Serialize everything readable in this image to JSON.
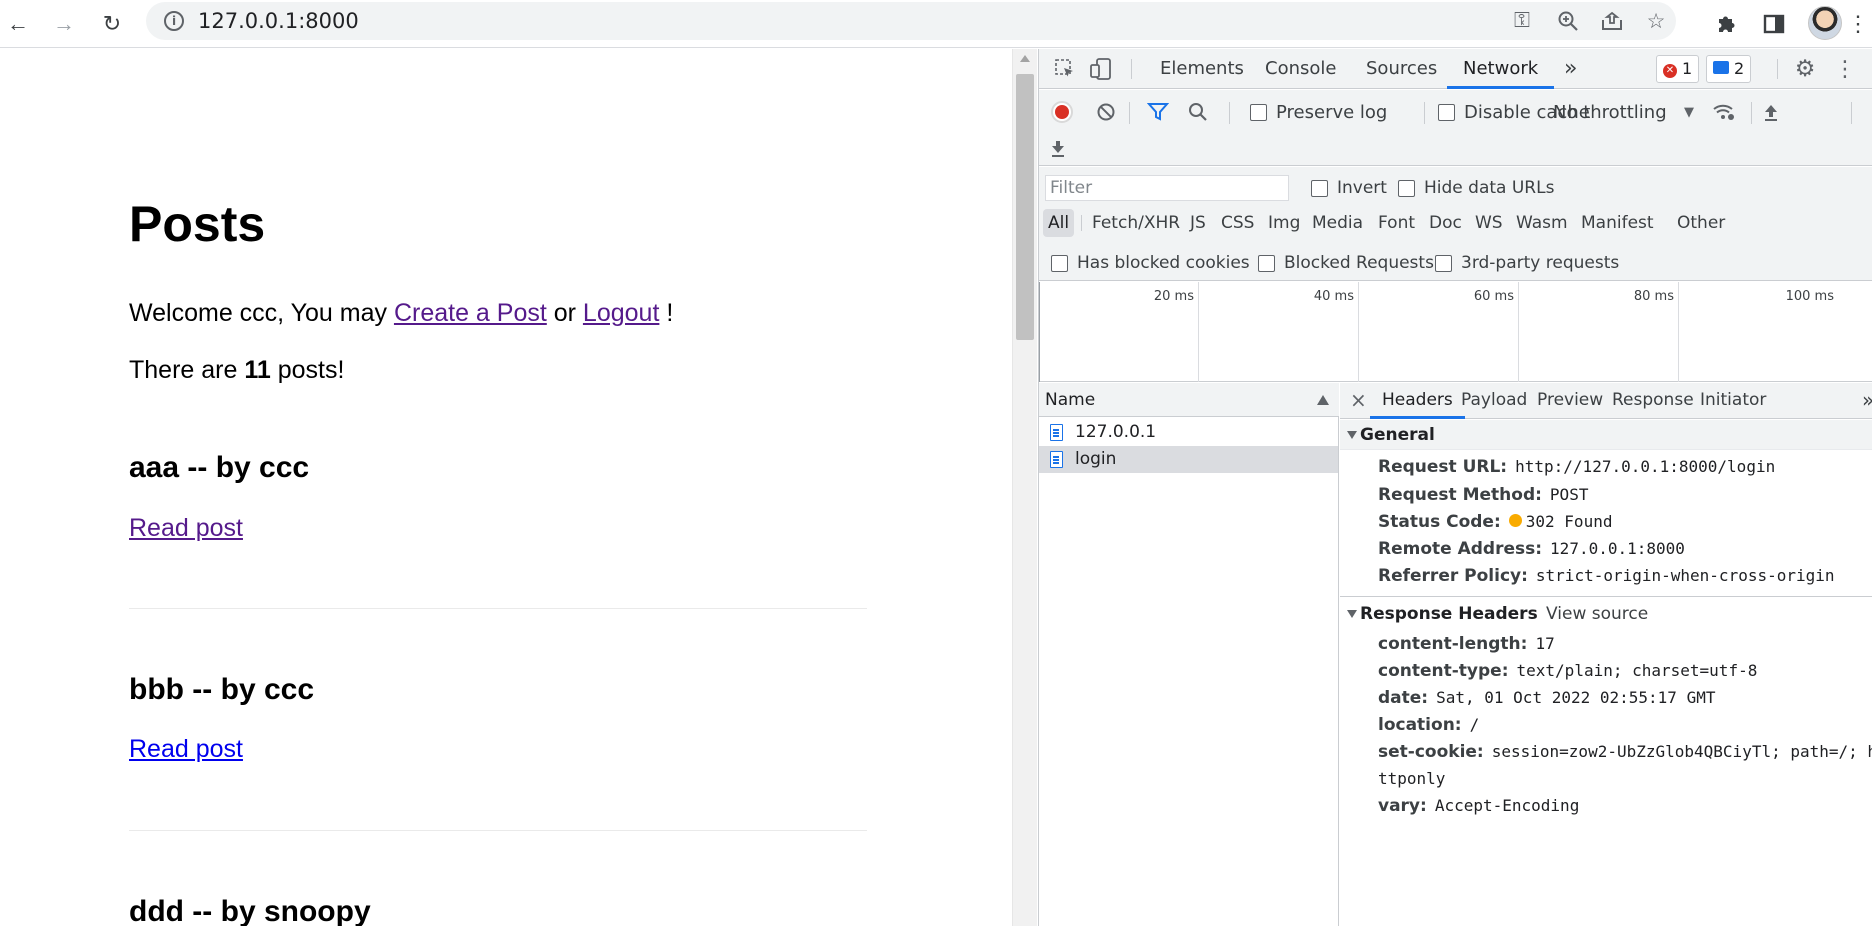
{
  "browser": {
    "url": "127.0.0.1:8000",
    "icons": {
      "back": "arrow-left-icon",
      "forward": "arrow-right-icon",
      "reload": "reload-icon",
      "site_info": "info-icon",
      "key": "key-icon",
      "zoom": "zoom-icon",
      "share": "share-icon",
      "bookmark": "star-icon",
      "extensions": "puzzle-icon",
      "side_panel": "side-panel-icon",
      "menu": "kebab-menu-icon"
    }
  },
  "page": {
    "title": "Posts",
    "welcome_prefix": "Welcome ccc, You may ",
    "create_link": "Create a Post",
    "or_text": " or ",
    "logout_link": "Logout",
    "welcome_suffix": " !",
    "count_prefix": "There are ",
    "count": "11",
    "count_suffix": " posts!",
    "posts": [
      {
        "title": "aaa -- by ccc",
        "link": "Read post"
      },
      {
        "title": "bbb -- by ccc",
        "link": "Read post"
      },
      {
        "title": "ddd -- by snoopy",
        "link": ""
      }
    ]
  },
  "devtools": {
    "tabs": [
      "Elements",
      "Console",
      "Sources",
      "Network"
    ],
    "active_tab": "Network",
    "more_tabs": "»",
    "error_count": "1",
    "message_count": "2",
    "toolbar": {
      "preserve_log": "Preserve log",
      "disable_cache": "Disable cache",
      "throttling": "No throttling"
    },
    "filter": {
      "placeholder": "Filter",
      "invert": "Invert",
      "hide_data_urls": "Hide data URLs",
      "types": [
        "All",
        "Fetch/XHR",
        "JS",
        "CSS",
        "Img",
        "Media",
        "Font",
        "Doc",
        "WS",
        "Wasm",
        "Manifest",
        "Other"
      ],
      "active_type": "All",
      "has_blocked_cookies": "Has blocked cookies",
      "blocked_requests": "Blocked Requests",
      "third_party": "3rd-party requests"
    },
    "timeline_ticks": [
      "20 ms",
      "40 ms",
      "60 ms",
      "80 ms",
      "100 ms"
    ],
    "name_header": "Name",
    "requests": [
      "127.0.0.1",
      "login"
    ],
    "selected_request": "login",
    "detail_tabs": [
      "Headers",
      "Payload",
      "Preview",
      "Response",
      "Initiator"
    ],
    "active_detail_tab": "Headers",
    "close_glyph": "×",
    "detail_more": "»",
    "general": {
      "title": "General",
      "rows": [
        {
          "k": "Request URL:",
          "v": "http://127.0.0.1:8000/login"
        },
        {
          "k": "Request Method:",
          "v": "POST"
        },
        {
          "k": "Status Code:",
          "v": "302 Found"
        },
        {
          "k": "Remote Address:",
          "v": "127.0.0.1:8000"
        },
        {
          "k": "Referrer Policy:",
          "v": "strict-origin-when-cross-origin"
        }
      ]
    },
    "response_headers": {
      "title": "Response Headers",
      "view_source": "View source",
      "rows": [
        {
          "k": "content-length:",
          "v": "17"
        },
        {
          "k": "content-type:",
          "v": "text/plain; charset=utf-8"
        },
        {
          "k": "date:",
          "v": "Sat, 01 Oct 2022 02:55:17 GMT"
        },
        {
          "k": "location:",
          "v": "/"
        },
        {
          "k": "set-cookie:",
          "v": "session=zow2-UbZzGlob4QBCiyTl; path=/; h"
        },
        {
          "k": "",
          "v": "ttponly"
        },
        {
          "k": "vary:",
          "v": "Accept-Encoding"
        }
      ]
    },
    "colors": {
      "accent": "#1a73e8",
      "record": "#d93025",
      "status_dot": "#f9ab00"
    }
  }
}
